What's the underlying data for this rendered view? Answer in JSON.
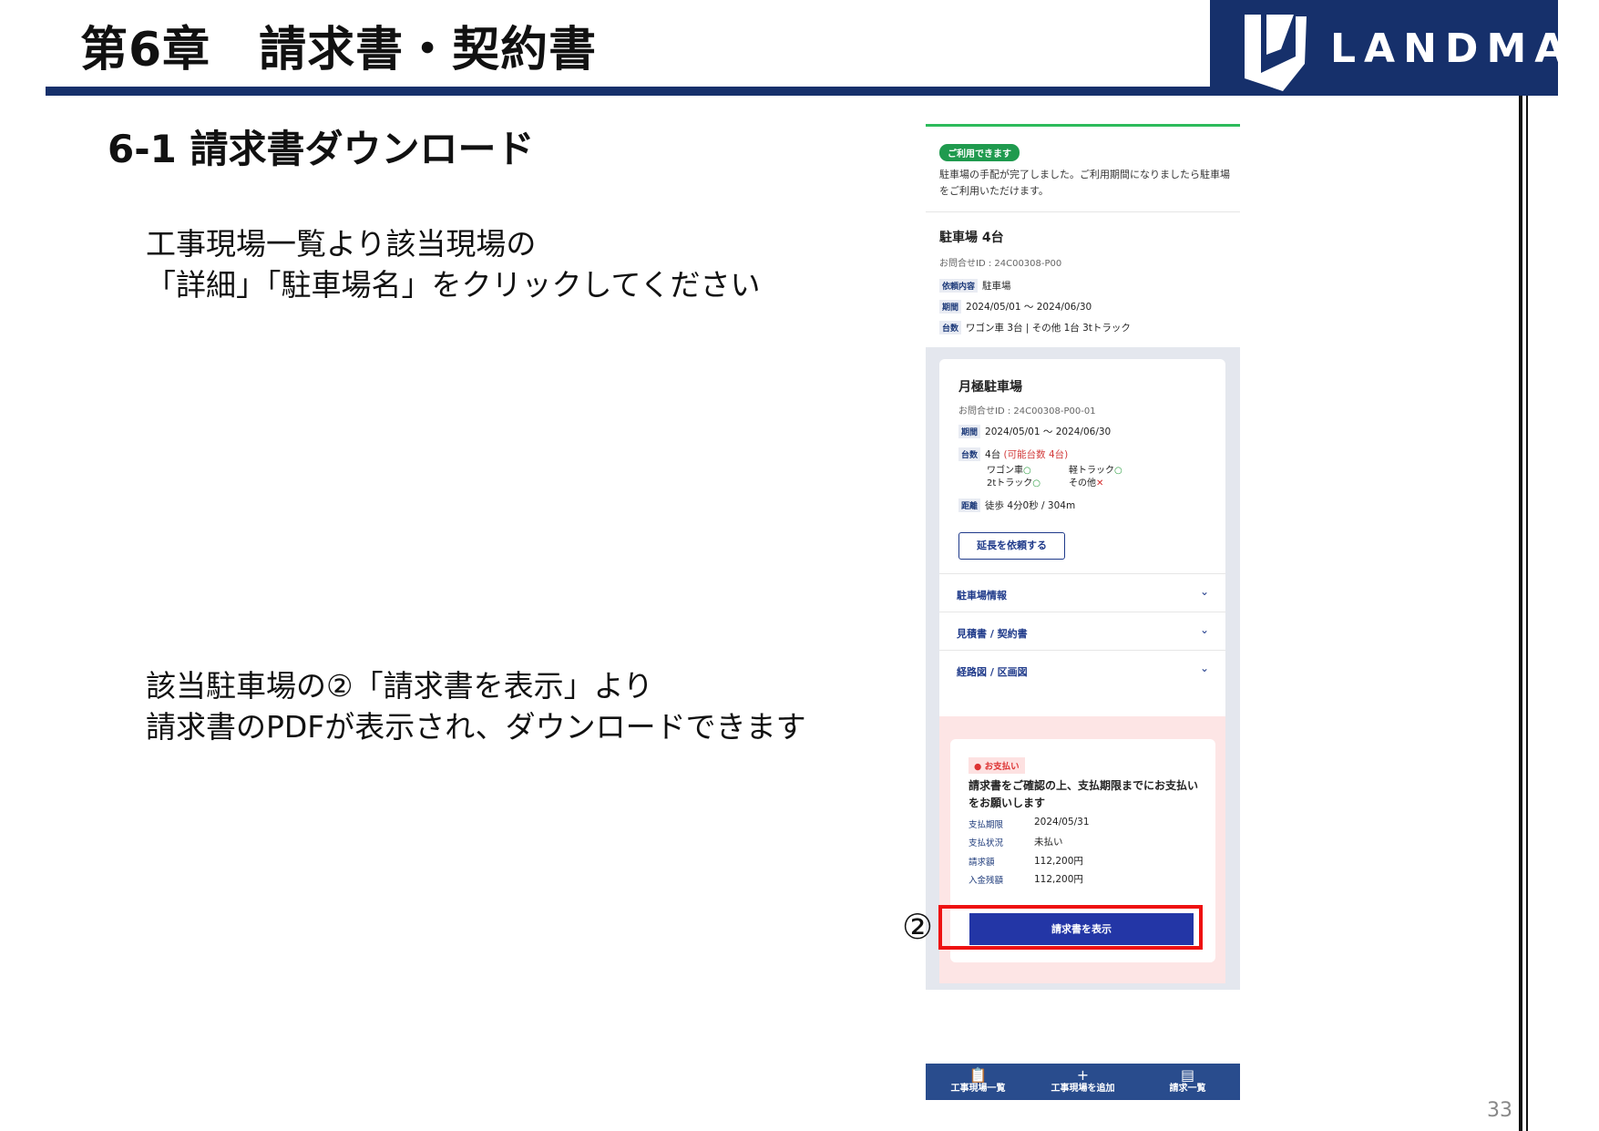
{
  "header": {
    "chapter_title": "第6章　請求書・契約書",
    "logo_text": "LANDMARK",
    "brand_color": "#16306b"
  },
  "section_title": "6-1 請求書ダウンロード",
  "instructions": [
    [
      "工事現場一覧より該当現場の",
      "「詳細」「駐車場名」をクリックしてください"
    ],
    [
      "該当駐車場の②「請求書を表示」より",
      "請求書のPDFが表示され、ダウンロードできます"
    ]
  ],
  "callout_marker": "②",
  "page_number": "33",
  "phone": {
    "status": {
      "badge": "ご利用できます",
      "message": "駐車場の手配が完了しました。ご利用期間になりましたら駐車場をご利用いただけます。"
    },
    "parking": {
      "title": "駐車場 4台",
      "inquiry": "お問合せID : 24C00308-P00",
      "rows": [
        {
          "label": "依頼内容",
          "value": "駐車場"
        },
        {
          "label": "期間",
          "value": "2024/05/01 ～ 2024/06/30"
        },
        {
          "label": "台数",
          "value": "ワゴン車 3台 | その他 1台 3tトラック"
        }
      ]
    },
    "lot": {
      "name": "月極駐車場",
      "inquiry": "お問合せID : 24C00308-P00-01",
      "period_label": "期間",
      "period": "2024/05/01 ～ 2024/06/30",
      "capacity_label": "台数",
      "capacity": "4台",
      "capacity_note": "(可能台数 4台)",
      "vehicles": [
        {
          "name": "ワゴン車",
          "mark": "○"
        },
        {
          "name": "軽トラック",
          "mark": "○"
        },
        {
          "name": "2tトラック",
          "mark": "○"
        },
        {
          "name": "その他",
          "mark": "✕"
        }
      ],
      "distance_label": "距離",
      "distance": "徒歩 4分0秒 / 304m",
      "extend_button": "延長を依頼する"
    },
    "accordions": [
      "駐車場情報",
      "見積書 / 契約書",
      "経路図 / 区画図"
    ],
    "chevron": "⌄",
    "payment": {
      "badge": "● お支払い",
      "message": "請求書をご確認の上、支払期限までにお支払いをお願いします",
      "rows": [
        {
          "label": "支払期限",
          "value": "2024/05/31"
        },
        {
          "label": "支払状況",
          "value": "未払い"
        },
        {
          "label": "請求額",
          "value": "112,200円"
        },
        {
          "label": "入金残額",
          "value": "112,200円"
        }
      ],
      "button": "請求書を表示"
    },
    "nav": [
      {
        "icon": "clipboard-icon",
        "glyph": "📋",
        "label": "工事現場一覧"
      },
      {
        "icon": "plus-icon",
        "glyph": "+",
        "label": "工事現場を追加"
      },
      {
        "icon": "list-icon",
        "glyph": "▤",
        "label": "請求一覧"
      }
    ]
  }
}
